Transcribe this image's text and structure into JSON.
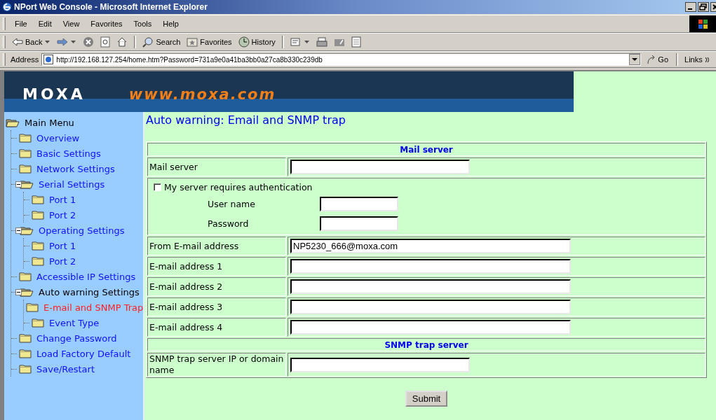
{
  "window": {
    "title": "NPort Web Console - Microsoft Internet Explorer"
  },
  "menu_bar": [
    "File",
    "Edit",
    "View",
    "Favorites",
    "Tools",
    "Help"
  ],
  "toolbar": [
    [
      {
        "kind": "back",
        "label": "Back",
        "has_menu": true
      },
      {
        "kind": "forward",
        "has_menu": true
      },
      {
        "kind": "stop",
        "has_menu": false
      },
      {
        "kind": "refresh",
        "has_menu": false
      },
      {
        "kind": "home",
        "has_menu": false
      }
    ],
    [
      {
        "kind": "search",
        "label": "Search",
        "has_menu": false
      },
      {
        "kind": "favorites",
        "label": "Favorites",
        "has_menu": false
      },
      {
        "kind": "history",
        "label": "History",
        "has_menu": false
      }
    ],
    [
      {
        "kind": "mail",
        "has_menu": true
      },
      {
        "kind": "print",
        "has_menu": false
      },
      {
        "kind": "edit",
        "has_menu": false
      },
      {
        "kind": "discuss",
        "has_menu": false
      }
    ]
  ],
  "address_bar": {
    "label": "Address",
    "value": "http://192.168.127.254/home.htm?Password=731a9e0a41ba3bb0a27ca8b330c239db",
    "go": "Go",
    "links": "Links"
  },
  "banner": {
    "logo": "MOXA",
    "website": "www.moxa.com"
  },
  "sidebar": {
    "tree": [
      {
        "label": "Main Menu",
        "expanded": true,
        "in_path": true,
        "selected": false,
        "children": [
          {
            "label": "Overview",
            "in_path": false,
            "selected": false
          },
          {
            "label": "Basic Settings",
            "in_path": false,
            "selected": false
          },
          {
            "label": "Network Settings",
            "in_path": false,
            "selected": false
          },
          {
            "label": "Serial Settings",
            "expanded": true,
            "in_path": false,
            "selected": false,
            "children": [
              {
                "label": "Port 1",
                "in_path": false,
                "selected": false
              },
              {
                "label": "Port 2",
                "in_path": false,
                "selected": false
              }
            ]
          },
          {
            "label": "Operating Settings",
            "expanded": true,
            "in_path": false,
            "selected": false,
            "children": [
              {
                "label": "Port 1",
                "in_path": false,
                "selected": false
              },
              {
                "label": "Port 2",
                "in_path": false,
                "selected": false
              }
            ]
          },
          {
            "label": "Accessible IP Settings",
            "in_path": false,
            "selected": false
          },
          {
            "label": "Auto warning Settings",
            "expanded": true,
            "in_path": true,
            "selected": false,
            "children": [
              {
                "label": "E-mail and SNMP Trap",
                "in_path": false,
                "selected": true
              },
              {
                "label": "Event Type",
                "in_path": false,
                "selected": false
              }
            ]
          },
          {
            "label": "Change Password",
            "in_path": false,
            "selected": false
          },
          {
            "label": "Load Factory Default",
            "in_path": false,
            "selected": false
          },
          {
            "label": "Save/Restart",
            "in_path": false,
            "selected": false
          }
        ]
      }
    ]
  },
  "content": {
    "heading": "Auto warning: Email and SNMP trap",
    "sections": [
      {
        "title": "Mail server",
        "rows": [
          {
            "kind": "short",
            "label": "Mail server"
          },
          {
            "kind": "auth",
            "label": "My server requires authentication",
            "checked": false,
            "fields": [
              {
                "label": "User name"
              },
              {
                "label": "Password"
              }
            ]
          },
          {
            "kind": "long",
            "label": "From E-mail address",
            "value": "NP5230_666@moxa.com"
          },
          {
            "kind": "long",
            "label": "E-mail address 1"
          },
          {
            "kind": "long",
            "label": "E-mail address 2"
          },
          {
            "kind": "long",
            "label": "E-mail address 3"
          },
          {
            "kind": "long",
            "label": "E-mail address 4"
          }
        ]
      },
      {
        "title": "SNMP trap server",
        "rows": [
          {
            "kind": "short",
            "label": "SNMP trap server IP or domain name"
          }
        ]
      }
    ],
    "submit": "Submit"
  }
}
